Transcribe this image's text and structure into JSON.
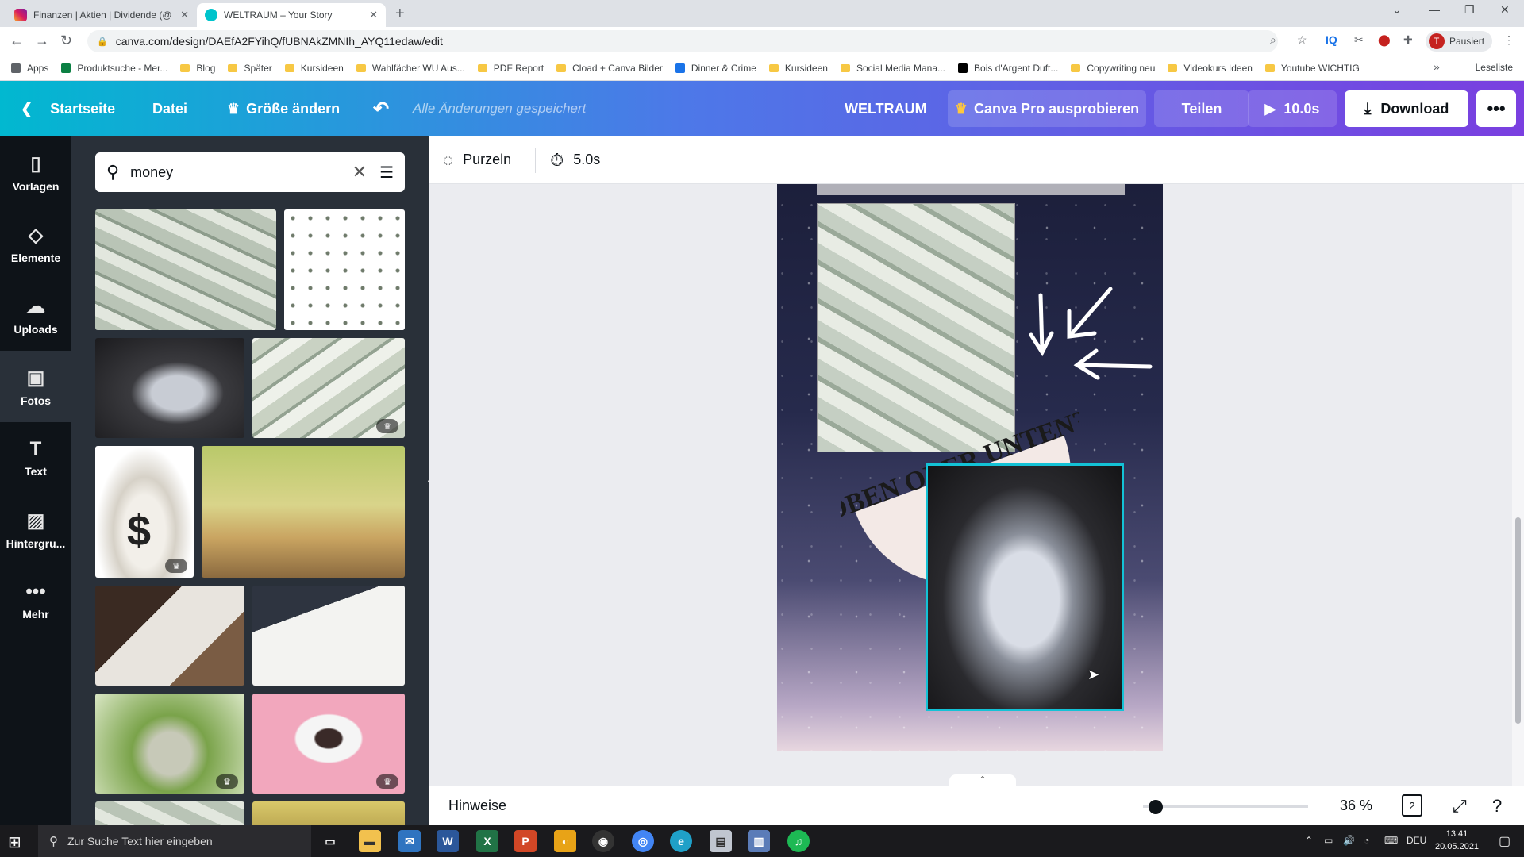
{
  "browser": {
    "tabs": [
      {
        "title": "Finanzen | Aktien | Dividende (@",
        "close": "✕"
      },
      {
        "title": "WELTRAUM – Your Story",
        "close": "✕"
      }
    ],
    "new_tab": "+",
    "url": "canva.com/design/DAEfA2FYihQ/fUBNAkZMNIh_AYQ11edaw/edit",
    "profile_initial": "T",
    "profile_label": "Pausiert",
    "bookmarks": [
      "Apps",
      "Produktsuche - Mer...",
      "Blog",
      "Später",
      "Kursideen",
      "Wahlfächer WU Aus...",
      "PDF Report",
      "Cload + Canva Bilder",
      "Dinner & Crime",
      "Kursideen",
      "Social Media Mana...",
      "Bois d'Argent Duft...",
      "Copywriting neu",
      "Videokurs Ideen",
      "Youtube WICHTIG"
    ],
    "bookmarks_more": "»",
    "reading_list": "Leseliste"
  },
  "header": {
    "home": "Startseite",
    "file": "Datei",
    "resize": "Größe ändern",
    "saved": "Alle Änderungen gespeichert",
    "design_title": "WELTRAUM",
    "pro": "Canva Pro ausprobieren",
    "share": "Teilen",
    "play": "10.0s",
    "download": "Download",
    "more": "•••"
  },
  "rail": [
    {
      "label": "Vorlagen",
      "icon": "▯"
    },
    {
      "label": "Elemente",
      "icon": "◇"
    },
    {
      "label": "Uploads",
      "icon": "☁"
    },
    {
      "label": "Fotos",
      "icon": "▣"
    },
    {
      "label": "Text",
      "icon": "T"
    },
    {
      "label": "Hintergru...",
      "icon": "▨"
    },
    {
      "label": "Mehr",
      "icon": "•••"
    }
  ],
  "search": {
    "value": "money"
  },
  "toolbar": {
    "animation": "Purzeln",
    "duration": "5.0s"
  },
  "design": {
    "text": "OBEN ODER UNTEN?"
  },
  "footer": {
    "notes": "Hinweise",
    "zoom": "36 %",
    "pages": "2",
    "zoom_level": 0.36
  },
  "taskbar": {
    "search_placeholder": "Zur Suche Text hier eingeben",
    "lang": "DEU",
    "time": "13:41",
    "date": "20.05.2021"
  },
  "colors": {
    "accent_selection": "#13c2d6",
    "rail_bg": "#0e1318",
    "panel_bg": "#293039"
  }
}
